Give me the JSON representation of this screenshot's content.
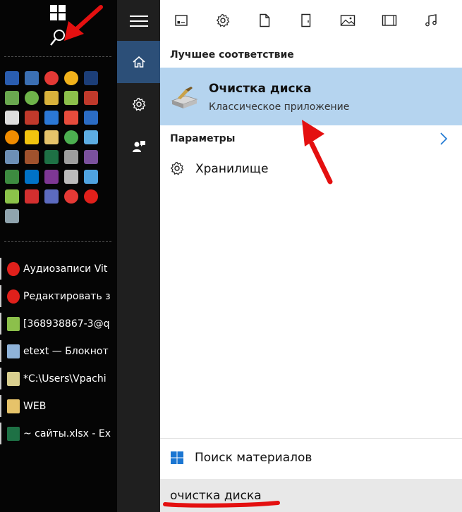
{
  "taskbar": {
    "start_icon": "windows-logo-icon",
    "search_icon": "search-icon",
    "tray_icons": [
      {
        "name": "monitor-icon",
        "color": "#2a5db0"
      },
      {
        "name": "window-icon",
        "color": "#3b6fb3"
      },
      {
        "name": "chrome-icon",
        "color": "#e53935"
      },
      {
        "name": "weather-icon",
        "color": "#f2b21b"
      },
      {
        "name": "photoshop-icon",
        "color": "#1c3e78"
      },
      {
        "name": "notepad-chart-icon",
        "color": "#6aa84f"
      },
      {
        "name": "utorrent-icon",
        "color": "#6fb44a"
      },
      {
        "name": "keys-icon",
        "color": "#d9b23b"
      },
      {
        "name": "android-icon",
        "color": "#8cc04b"
      },
      {
        "name": "filezilla-icon",
        "color": "#c0392b"
      },
      {
        "name": "font-a-icon",
        "color": "#dddddd"
      },
      {
        "name": "hand-icon",
        "color": "#c0392b"
      },
      {
        "name": "teamviewer-icon",
        "color": "#2b78d6"
      },
      {
        "name": "paint-icon",
        "color": "#e74c3c"
      },
      {
        "name": "intel-icon",
        "color": "#2b6cc4"
      },
      {
        "name": "vlc-icon",
        "color": "#f08c00"
      },
      {
        "name": "palette-icon",
        "color": "#f1c40f"
      },
      {
        "name": "folder-icon",
        "color": "#e6c36a"
      },
      {
        "name": "globe-icon",
        "color": "#4caf50"
      },
      {
        "name": "ie-mobile-icon",
        "color": "#5dade2"
      },
      {
        "name": "display-icon",
        "color": "#6d8fb5"
      },
      {
        "name": "tools-icon",
        "color": "#a0522d"
      },
      {
        "name": "excel-icon",
        "color": "#1e7145"
      },
      {
        "name": "calculator-icon",
        "color": "#9e9e9e"
      },
      {
        "name": "viber-icon",
        "color": "#7b519d"
      },
      {
        "name": "network-icon",
        "color": "#3d8b40"
      },
      {
        "name": "outlook-icon",
        "color": "#0072c6"
      },
      {
        "name": "onenote-icon",
        "color": "#7e3794"
      },
      {
        "name": "cursor-icon",
        "color": "#bbbbbb"
      },
      {
        "name": "remote-icon",
        "color": "#4fa3e0"
      },
      {
        "name": "stack-icon",
        "color": "#8bc34a"
      },
      {
        "name": "aida64-icon",
        "color": "#d32f2f"
      },
      {
        "name": "floppy-icon",
        "color": "#5c6bc0"
      },
      {
        "name": "cards-icon",
        "color": "#e53935"
      },
      {
        "name": "opera-icon",
        "color": "#e0201b"
      },
      {
        "name": "users-icon",
        "color": "#90a4ae"
      }
    ],
    "tasks": [
      {
        "icon": "opera-icon",
        "color": "#e0201b",
        "label": "Аудиозаписи Vit"
      },
      {
        "icon": "opera-icon",
        "color": "#e0201b",
        "label": "Редактировать з"
      },
      {
        "icon": "android-file-icon",
        "color": "#8cc04b",
        "label": "[368938867-3@q"
      },
      {
        "icon": "notepad-icon",
        "color": "#8fb3d9",
        "label": "etext — Блокнот"
      },
      {
        "icon": "notepad-edit-icon",
        "color": "#d9cf8f",
        "label": "*C:\\Users\\Vpachi"
      },
      {
        "icon": "folder-icon",
        "color": "#e6c36a",
        "label": "WEB"
      },
      {
        "icon": "excel-icon",
        "color": "#1e7145",
        "label": "~ сайты.xlsx - Ex"
      }
    ]
  },
  "side_strip": {
    "menu_icon": "hamburger-icon",
    "home_icon": "home-icon",
    "settings_icon": "gear-icon",
    "feedback_icon": "feedback-icon",
    "accent": "#2c4f78"
  },
  "filters": [
    {
      "name": "filter-apps",
      "icon": "apps-icon"
    },
    {
      "name": "filter-settings",
      "icon": "gear-icon"
    },
    {
      "name": "filter-documents",
      "icon": "document-icon"
    },
    {
      "name": "filter-folders",
      "icon": "folder-outline-icon"
    },
    {
      "name": "filter-photos",
      "icon": "photo-icon"
    },
    {
      "name": "filter-videos",
      "icon": "video-icon"
    },
    {
      "name": "filter-music",
      "icon": "music-icon"
    }
  ],
  "results": {
    "best_header": "Лучшее соответствие",
    "best_title": "Очистка диска",
    "best_subtitle": "Классическое приложение",
    "best_icon": "disk-cleanup-icon",
    "highlight_color": "#b5d4ef",
    "settings_header": "Параметры",
    "settings_items": [
      {
        "icon": "gear-icon",
        "label": "Хранилище"
      }
    ]
  },
  "web_search": {
    "icon": "windows-logo-icon",
    "label": "Поиск материалов"
  },
  "search": {
    "value": "очистка диска"
  },
  "annotation_color": "#e41010"
}
